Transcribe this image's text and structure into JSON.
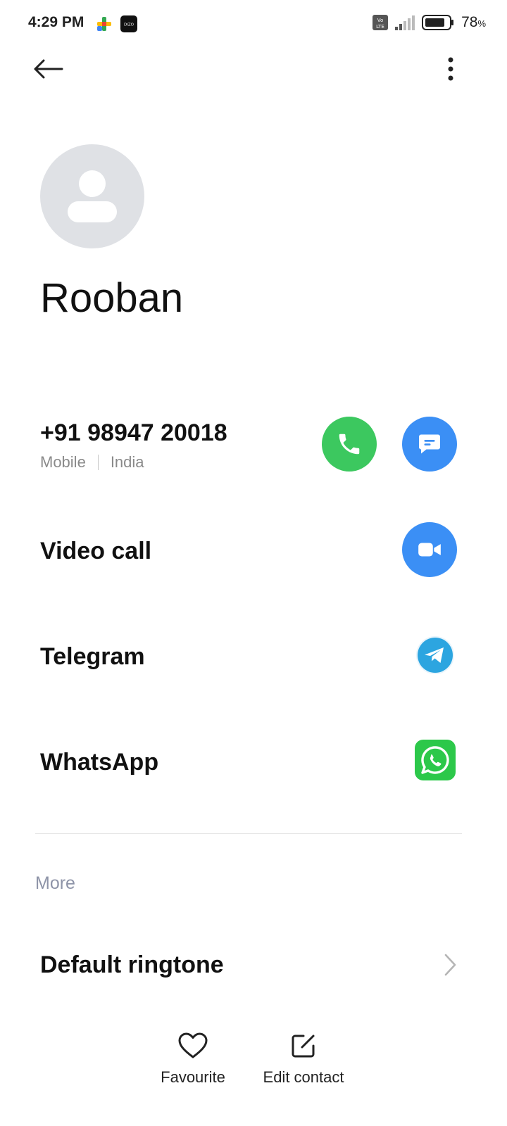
{
  "status_bar": {
    "time": "4:29 PM",
    "battery_value": "78",
    "battery_unit": "%",
    "network_label": "Vo LTE",
    "app_badge": "DIZO"
  },
  "contact": {
    "name": "Rooban",
    "phone": "+91 98947 20018",
    "phone_type": "Mobile",
    "phone_region": "India"
  },
  "actions": {
    "video_call": "Video call",
    "telegram": "Telegram",
    "whatsapp": "WhatsApp"
  },
  "more": {
    "header": "More",
    "default_ringtone": "Default ringtone"
  },
  "bottom_bar": {
    "favourite": "Favourite",
    "edit_contact": "Edit contact"
  },
  "colors": {
    "call_green": "#3cc85f",
    "action_blue": "#3b8ff5",
    "telegram_blue": "#2ca5e0",
    "whatsapp_green": "#2cc84a",
    "avatar_grey": "#dfe1e5",
    "section_grey": "#8e94a8"
  },
  "icons": [
    "back-arrow-icon",
    "more-vert-icon",
    "person-icon",
    "phone-icon",
    "message-icon",
    "videocam-icon",
    "telegram-icon",
    "whatsapp-icon",
    "chevron-right-icon",
    "heart-icon",
    "edit-icon"
  ]
}
